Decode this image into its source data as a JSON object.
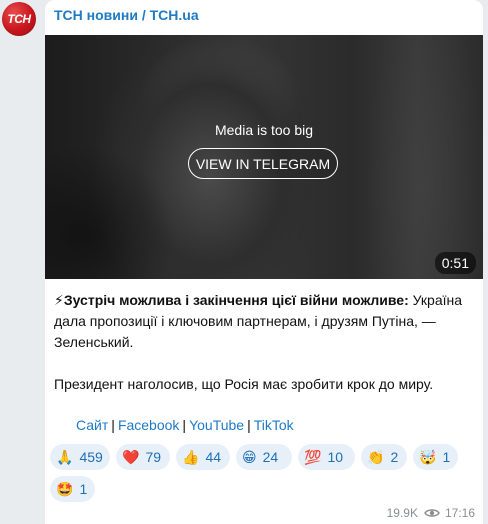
{
  "channel": {
    "avatar_text": "ТСН",
    "name": "ТСН новини / TCH.ua",
    "brand_color": "#c8161d",
    "link_color": "#1f7ac6"
  },
  "media": {
    "notice": "Media is too big",
    "button_label": "VIEW IN TELEGRAM",
    "duration": "0:51"
  },
  "post": {
    "headline_icon": "⚡",
    "headline": "Зустріч можлива і закінчення цієї війни можливе:",
    "body_1": " Україна дала пропозиції і ключовим партнерам, і друзям Путіна, — Зеленський.",
    "body_2": "Президент наголосив, що Росія має зробити крок до миру."
  },
  "links": {
    "site": "Сайт",
    "facebook": "Facebook",
    "youtube": "YouTube",
    "tiktok": "TikTok",
    "separator": "|"
  },
  "reactions": [
    {
      "emoji": "🙏",
      "icon": "praying-hands",
      "count": "459"
    },
    {
      "emoji": "❤️",
      "icon": "red-heart",
      "count": "79"
    },
    {
      "emoji": "👍",
      "icon": "thumbs-up",
      "count": "44"
    },
    {
      "emoji": "😁",
      "icon": "beaming-face",
      "count": "24"
    },
    {
      "emoji": "💯",
      "icon": "hundred-points",
      "count": "10"
    },
    {
      "emoji": "👏",
      "icon": "clapping-hands",
      "count": "2"
    },
    {
      "emoji": "🤯",
      "icon": "exploding-head",
      "count": "1"
    },
    {
      "emoji": "🤩",
      "icon": "star-struck",
      "count": "1"
    }
  ],
  "footer": {
    "views": "19.9K",
    "time": "17:16"
  }
}
